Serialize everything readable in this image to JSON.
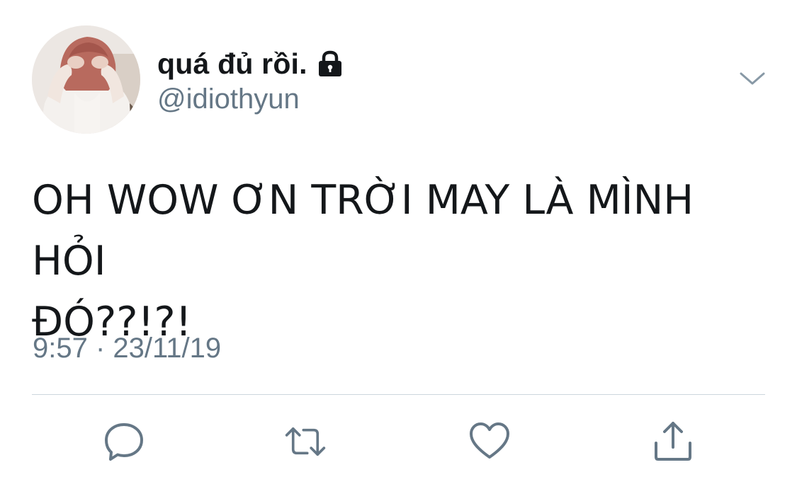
{
  "author": {
    "display_name": "quá đủ rồi.",
    "handle": "@idiothyun",
    "protected_icon": "lock-icon",
    "avatar": "profile-photo"
  },
  "tweet": {
    "text_line_1": "OH WOW ƠN TRỜI MAY LÀ MÌNH HỎI",
    "text_line_2": "ĐÓ??!?!",
    "timestamp": "9:57 · 23/11/19"
  },
  "menu_icon": "chevron-down-icon",
  "actions": [
    {
      "name": "reply",
      "icon": "reply-icon"
    },
    {
      "name": "retweet",
      "icon": "retweet-icon"
    },
    {
      "name": "like",
      "icon": "heart-icon"
    },
    {
      "name": "share",
      "icon": "share-icon"
    }
  ],
  "colors": {
    "text_primary": "#14171a",
    "text_secondary": "#657786",
    "icon": "#657786",
    "divider": "#ccd6dd",
    "background": "#ffffff"
  }
}
